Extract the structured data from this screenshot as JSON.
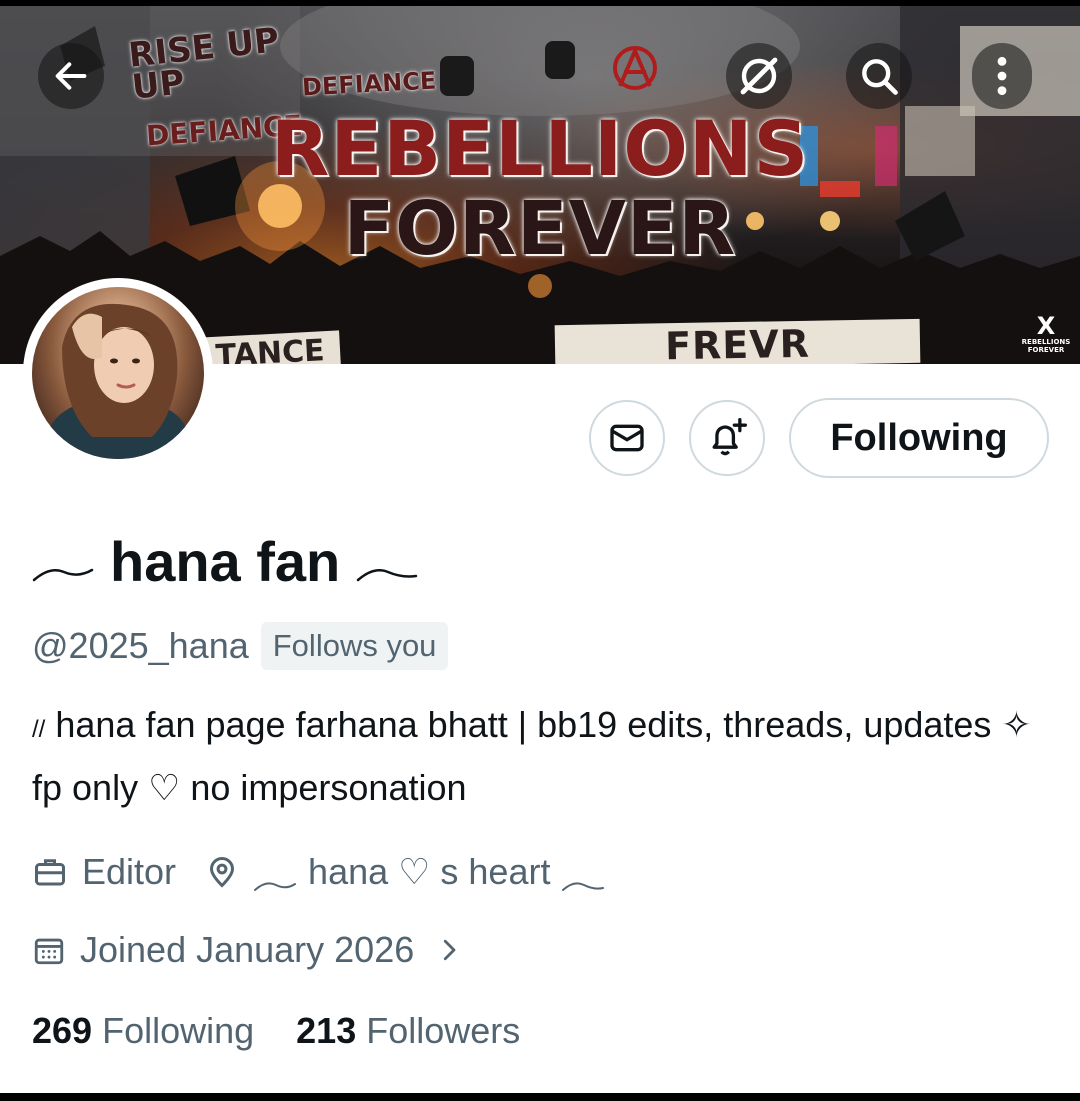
{
  "banner": {
    "title_line1": "REBELLIONS",
    "title_line2": "FOREVER",
    "graffiti_rise_up": "RISE UP\nUP",
    "graffiti_defiance_1": "DEFIANCE",
    "graffiti_defiance_2": "DEFIANCE",
    "bottom_banner_text": "FREVR REBELLION",
    "left_banner_text": "TANCE",
    "logo_text": "REBELLIONS FOREVER",
    "logo_mark": "X"
  },
  "toolbar": {
    "back_icon": "arrow-left-icon",
    "grok_icon": "grok-icon",
    "search_icon": "search-icon",
    "more_icon": "more-vertical-icon"
  },
  "profile": {
    "display_name": "hana fan",
    "handle": "@2025_hana",
    "follows_you": "Follows you",
    "bio_prefix": "//",
    "bio_text": "hana fan page farhana bhatt | bb19 edits, threads, updates ✧ fp only ♡ no impersonation",
    "profession": "Editor",
    "location": "hana ♡ s heart",
    "joined": "Joined January 2026",
    "following_count": "269",
    "following_label": "Following",
    "followers_count": "213",
    "followers_label": "Followers"
  },
  "actions": {
    "message_icon": "mail-icon",
    "notify_icon": "bell-plus-icon",
    "following_button": "Following"
  },
  "colors": {
    "text_primary": "#0f1419",
    "text_secondary": "#536471",
    "border": "#cfd9de",
    "badge_bg": "#eff3f4"
  }
}
